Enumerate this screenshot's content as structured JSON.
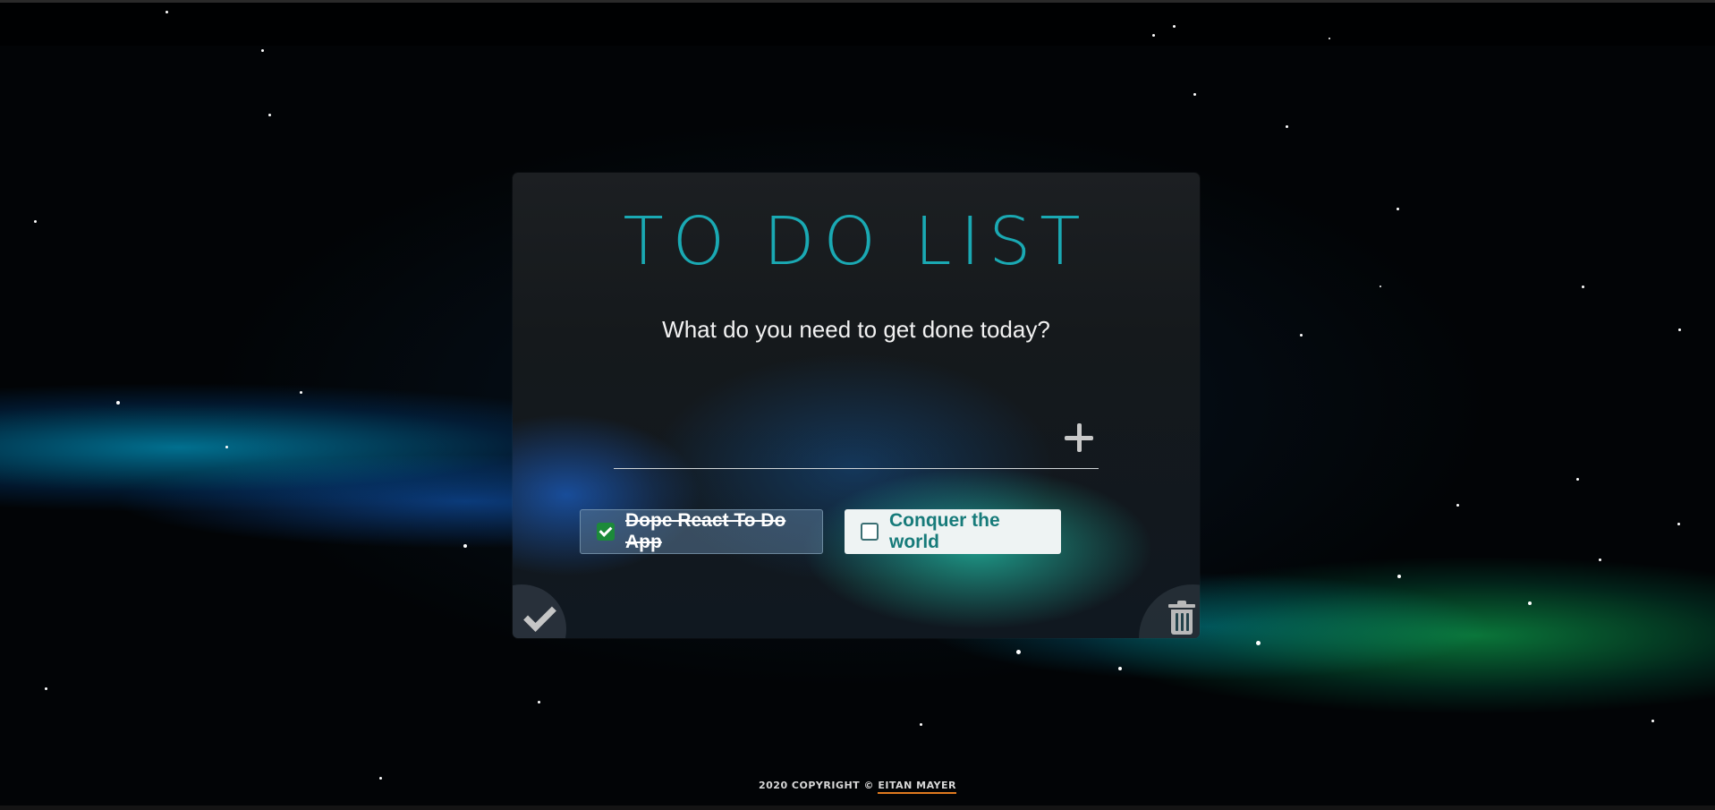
{
  "app": {
    "title": "TO DO LIST",
    "subtitle": "What do you need to get done today?"
  },
  "input": {
    "value": "",
    "placeholder": "",
    "add_icon": "plus-icon"
  },
  "todos": [
    {
      "label": "Dope React To Do App",
      "completed": true
    },
    {
      "label": "Conquer the world",
      "completed": false
    }
  ],
  "actions": {
    "complete_icon": "check-icon",
    "delete_icon": "trash-icon"
  },
  "footer": {
    "text": "2020 COPYRIGHT © ",
    "author": "EITAN MAYER"
  },
  "colors": {
    "title": "#1aa9b3",
    "todo_open_text": "#177b7a",
    "checkbox_checked": "#1c8a3a",
    "footer_underline": "#e07a1f"
  }
}
